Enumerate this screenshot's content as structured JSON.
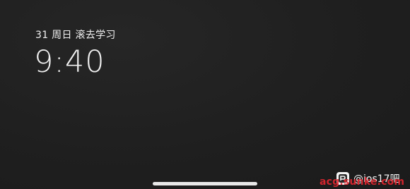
{
  "lock_screen": {
    "date_text": "31 周日  滚去学习",
    "time": "9:40"
  },
  "watermark": {
    "handle": "@ios17吧",
    "site": "acg.sunke.com",
    "logo_icon": "app-logo-icon",
    "site_color": "#e0262f"
  },
  "home_indicator": {
    "icon": "home-indicator-bar"
  }
}
